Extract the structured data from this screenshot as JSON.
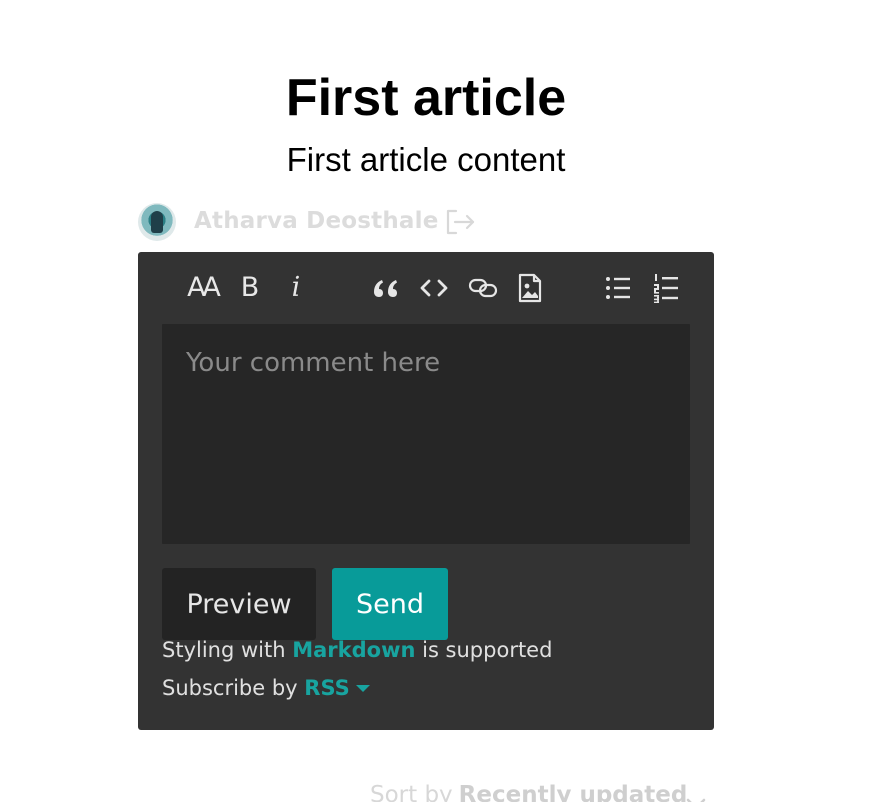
{
  "article": {
    "title": "First article",
    "content": "First article content"
  },
  "user": {
    "name": "Atharva Deosthale"
  },
  "editor": {
    "toolbar": {
      "heading_label": "AA",
      "bold_label": "B",
      "italic_label": "i",
      "icons": [
        "heading-icon",
        "bold-icon",
        "italic-icon",
        "quote-icon",
        "code-icon",
        "link-icon",
        "image-icon",
        "bullet-list-icon",
        "numbered-list-icon"
      ]
    },
    "comment_placeholder": "Your comment here",
    "comment_value": "",
    "preview_label": "Preview",
    "send_label": "Send",
    "markdown_prefix": "Styling with",
    "markdown_link": "Markdown",
    "markdown_suffix": "is supported",
    "subscribe_prefix": "Subscribe by",
    "subscribe_link": "RSS"
  },
  "sort": {
    "label": "Sort by",
    "value": "Recently updated"
  },
  "colors": {
    "accent": "#089b99",
    "panel": "#333333",
    "textarea": "#262626"
  }
}
